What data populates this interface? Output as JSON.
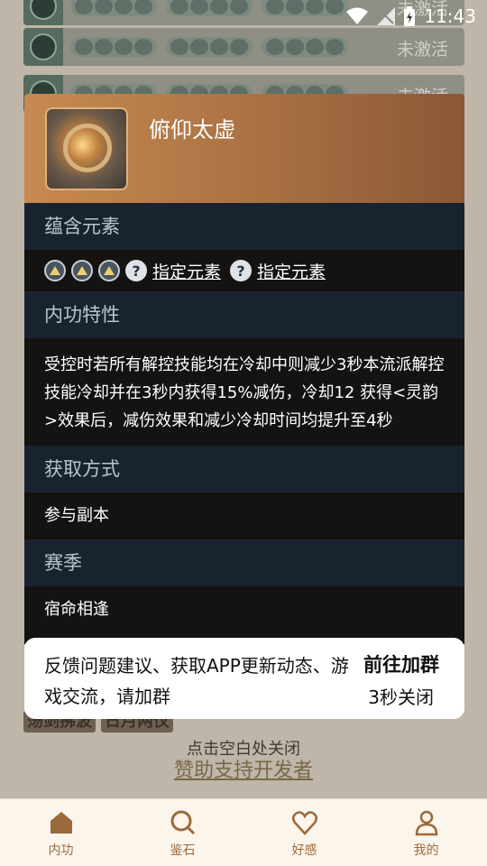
{
  "status_bar": {
    "time": "11:43"
  },
  "background_list": {
    "rows": [
      {
        "status": "未激活"
      },
      {
        "status": "未激活"
      },
      {
        "status": "未激活"
      }
    ],
    "tags": [
      "荡剑拂波",
      "日月两仪"
    ],
    "close_hint": "点击空白处关闭",
    "sponsor_link": "赞助支持开发者"
  },
  "card": {
    "title": "俯仰太虚",
    "sections": {
      "elements_header": "蕴含元素",
      "element_link_1": "指定元素",
      "element_link_2": "指定元素",
      "trait_header": "内功特性",
      "trait_desc": "受控时若所有解控技能均在冷却中则减少3秒本流派解控技能冷却并在3秒内获得15%减伤，冷却12 获得<灵韵>效果后，减伤效果和减少冷却时间均提升至4秒",
      "obtain_header": "获取方式",
      "obtain_value": "参与副本",
      "season_header": "赛季",
      "season_value": "宿命相逢"
    }
  },
  "toast": {
    "message": "反馈问题建议、获取APP更新动态、游戏交流，请加群",
    "join_label": "前往加群",
    "countdown": "3秒关闭"
  },
  "nav": {
    "items": [
      {
        "label": "内功",
        "icon": "home-icon"
      },
      {
        "label": "鉴石",
        "icon": "search-icon"
      },
      {
        "label": "好感",
        "icon": "heart-icon"
      },
      {
        "label": "我的",
        "icon": "user-icon"
      }
    ]
  },
  "colors": {
    "card_header": "#c78a50",
    "section_header": "#192330",
    "card_body": "#141311",
    "nav_accent": "#9c6a3a"
  }
}
